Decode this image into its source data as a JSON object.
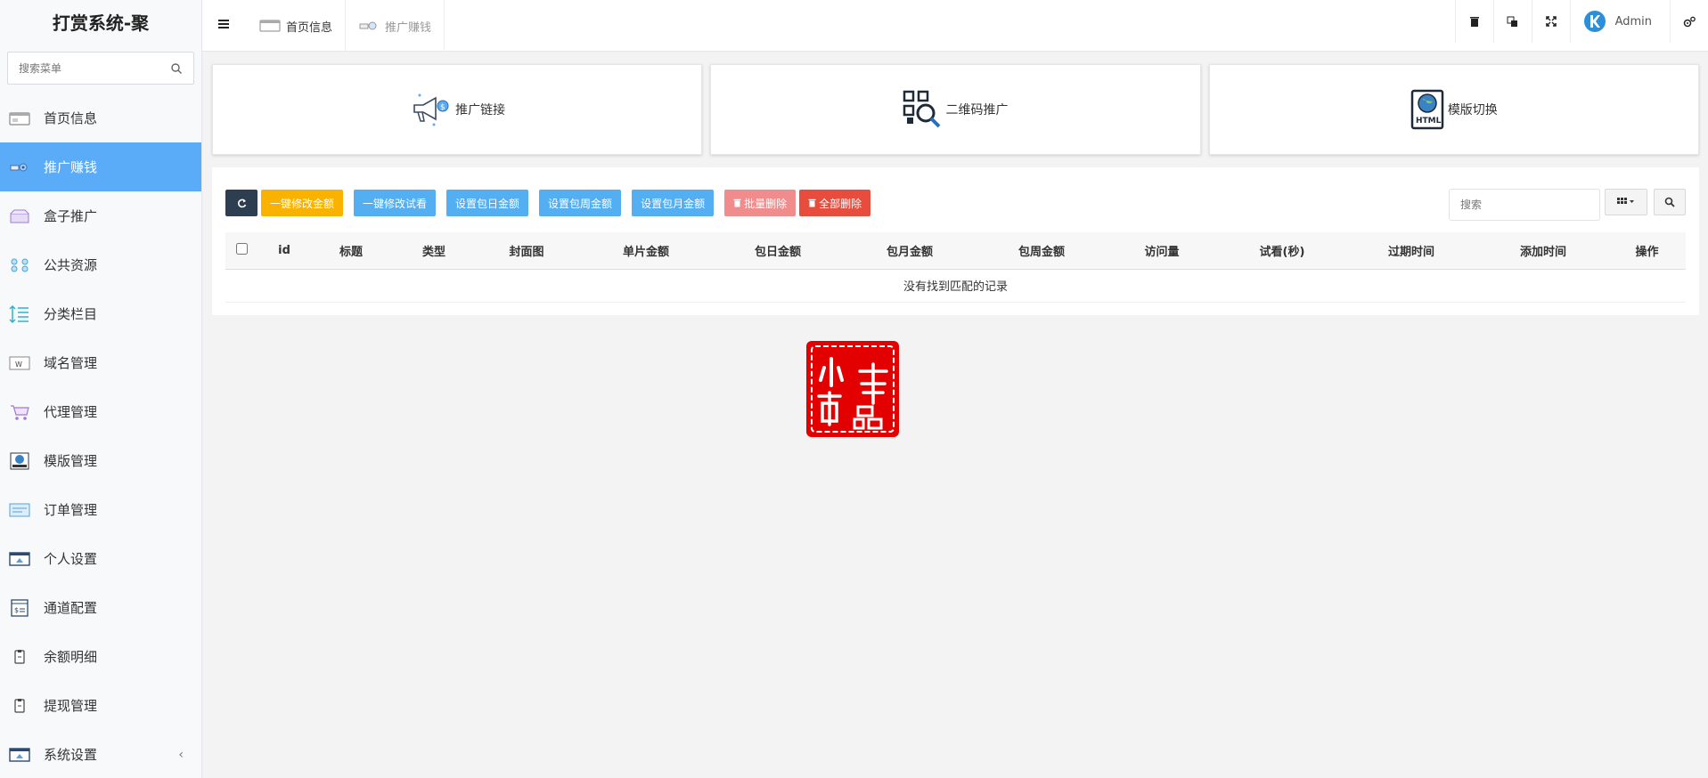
{
  "sidebar": {
    "brand": "打赏系统-聚",
    "search_placeholder": "搜索菜单",
    "items": [
      {
        "label": "首页信息",
        "icon": "home-card-icon"
      },
      {
        "label": "推广赚钱",
        "icon": "promo-icon",
        "active": true
      },
      {
        "label": "盒子推广",
        "icon": "box-icon"
      },
      {
        "label": "公共资源",
        "icon": "resource-icon"
      },
      {
        "label": "分类栏目",
        "icon": "sort-icon"
      },
      {
        "label": "域名管理",
        "icon": "domain-icon"
      },
      {
        "label": "代理管理",
        "icon": "cart-icon"
      },
      {
        "label": "模版管理",
        "icon": "template-icon"
      },
      {
        "label": "订单管理",
        "icon": "order-icon"
      },
      {
        "label": "个人设置",
        "icon": "profile-icon"
      },
      {
        "label": "通道配置",
        "icon": "channel-icon"
      },
      {
        "label": "余额明细",
        "icon": "balance-icon"
      },
      {
        "label": "提现管理",
        "icon": "withdraw-icon"
      },
      {
        "label": "系统设置",
        "icon": "settings-icon"
      }
    ],
    "collapse_caret": "‹"
  },
  "topbar": {
    "tabs": [
      {
        "label": "首页信息"
      },
      {
        "label": "推广赚钱"
      }
    ],
    "admin_name": "Admin"
  },
  "cards": [
    {
      "label": "推广链接",
      "icon": "megaphone-icon"
    },
    {
      "label": "二维码推广",
      "icon": "qrcode-search-icon"
    },
    {
      "label": "模版切换",
      "icon": "html-globe-icon"
    }
  ],
  "toolbar": {
    "btn_edit_amount": "一键修改金额",
    "btn_edit_trial": "一键修改试看",
    "btn_daily": "设置包日金额",
    "btn_weekly": "设置包周金额",
    "btn_monthly": "设置包月金额",
    "btn_batch_delete": "批量删除",
    "btn_delete_all": "全部删除",
    "search_placeholder": "搜索"
  },
  "table": {
    "columns": [
      "id",
      "标题",
      "类型",
      "封面图",
      "单片金额",
      "包日金额",
      "包月金额",
      "包周金额",
      "访问量",
      "试看(秒)",
      "过期时间",
      "添加时间",
      "操作"
    ],
    "empty_text": "没有找到匹配的记录"
  },
  "seal": {
    "text": "小码精品"
  },
  "colors": {
    "active_menu": "#5aabf8",
    "dark_btn": "#2c3e50",
    "yellow_btn": "#f9b200",
    "blue_btn": "#53aef2",
    "pink_btn": "#f08c8c",
    "red_btn": "#e74c3c"
  }
}
